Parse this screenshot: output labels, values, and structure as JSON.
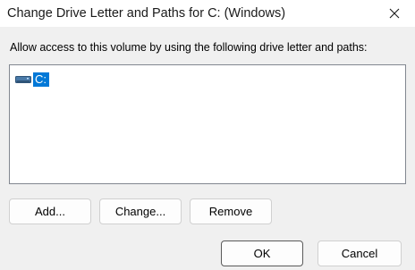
{
  "window": {
    "title": "Change Drive Letter and Paths for C: (Windows)",
    "close_icon": "close-icon"
  },
  "description": "Allow access to this volume by using the following drive letter and paths:",
  "list": {
    "items": [
      {
        "icon": "drive-icon",
        "label": "C:",
        "selected": true
      }
    ]
  },
  "buttons": {
    "add": "Add...",
    "change": "Change...",
    "remove": "Remove",
    "ok": "OK",
    "cancel": "Cancel"
  },
  "colors": {
    "selection": "#0078d7",
    "dialog_bg": "#f0f0f0",
    "titlebar_bg": "#ffffff"
  }
}
